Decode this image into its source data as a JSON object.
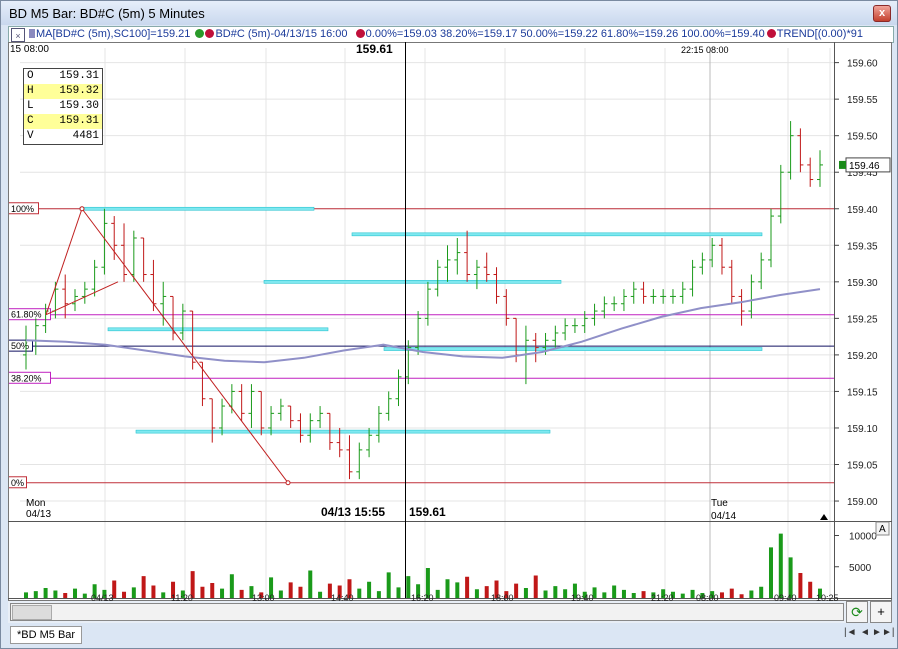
{
  "window": {
    "title": "BD M5 Bar: BD#C (5m) 5 Minutes",
    "close_glyph": "x"
  },
  "legend": {
    "items": [
      {
        "text": "MA[BD#C (5m),SC100]=159.21",
        "color": "#8a8abf"
      },
      {
        "text": "BD#C (5m)-04/13/15 16:00",
        "color": "#2a9a2a"
      },
      {
        "text": "0.00%=159.03 38.20%=159.17 50.00%=159.22 61.80%=159.26 100.00%=159.40",
        "color": "#c0103a"
      },
      {
        "text": "TREND[(0.00)*91",
        "color": "#c0103a"
      }
    ]
  },
  "chart_header": {
    "left_date": "15 08:00",
    "cursor_price": "159.61",
    "right_time": "22:15 08:00"
  },
  "ohlc_box": [
    {
      "k": "O",
      "v": "159.31",
      "hl": false
    },
    {
      "k": "H",
      "v": "159.32",
      "hl": true
    },
    {
      "k": "L",
      "v": "159.30",
      "hl": false
    },
    {
      "k": "C",
      "v": "159.31",
      "hl": true
    },
    {
      "k": "V",
      "v": "4481",
      "hl": false
    }
  ],
  "fib_levels": [
    {
      "label": "100%",
      "price": 159.4,
      "color": "#c0303a"
    },
    {
      "label": "61.80%",
      "price": 159.255,
      "color": "#c020c0"
    },
    {
      "label": "50%",
      "price": 159.212,
      "color": "#101060"
    },
    {
      "label": "38.20%",
      "price": 159.168,
      "color": "#c020c0"
    },
    {
      "label": "0%",
      "price": 159.025,
      "color": "#c0303a"
    }
  ],
  "price_axis": {
    "ticks": [
      "159.60",
      "159.55",
      "159.50",
      "159.45",
      "159.40",
      "159.35",
      "159.30",
      "159.25",
      "159.20",
      "159.15",
      "159.10",
      "159.05",
      "159.00"
    ],
    "last_price": "159.46",
    "last_price_color": "#1a8a1a"
  },
  "volume_axis": {
    "ticks": [
      "10000",
      "5000"
    ],
    "mode_button": "A"
  },
  "time_axis": {
    "ticks": [
      "04/13",
      "11:20",
      "13:00",
      "14:40",
      "16:20",
      "18:00",
      "19:40",
      "21:20",
      "08:00",
      "09:40",
      "10:25"
    ]
  },
  "day_labels": [
    {
      "day": "Mon",
      "date": "04/13"
    },
    {
      "day": "Tue",
      "date": "04/14"
    }
  ],
  "cursor_readout": {
    "datetime": "04/13 15:55",
    "price": "159.61"
  },
  "bottom": {
    "sync_glyph": "⟳",
    "plus_glyph": "+"
  },
  "tabs": [
    {
      "label": "*BD M5 Bar"
    }
  ],
  "tab_nav": {
    "first": "|◄",
    "prev": "◄",
    "next": "►",
    "last": "►|"
  },
  "chart_data": {
    "type": "bar",
    "symbol": "BD#C (5m)",
    "ylim": [
      158.985,
      159.62
    ],
    "price_bars": [
      [
        159.2,
        159.24,
        159.18,
        159.22
      ],
      [
        159.22,
        159.25,
        159.2,
        159.24
      ],
      [
        159.24,
        159.27,
        159.23,
        159.26
      ],
      [
        159.26,
        159.3,
        159.25,
        159.29
      ],
      [
        159.29,
        159.31,
        159.25,
        159.27
      ],
      [
        159.27,
        159.29,
        159.26,
        159.28
      ],
      [
        159.28,
        159.3,
        159.27,
        159.29
      ],
      [
        159.29,
        159.33,
        159.28,
        159.32
      ],
      [
        159.32,
        159.4,
        159.31,
        159.38
      ],
      [
        159.38,
        159.39,
        159.33,
        159.35
      ],
      [
        159.35,
        159.38,
        159.3,
        159.31
      ],
      [
        159.31,
        159.37,
        159.3,
        159.36
      ],
      [
        159.36,
        159.36,
        159.3,
        159.31
      ],
      [
        159.31,
        159.33,
        159.26,
        159.27
      ],
      [
        159.27,
        159.3,
        159.24,
        159.28
      ],
      [
        159.28,
        159.28,
        159.22,
        159.23
      ],
      [
        159.23,
        159.27,
        159.22,
        159.26
      ],
      [
        159.26,
        159.26,
        159.18,
        159.19
      ],
      [
        159.19,
        159.19,
        159.13,
        159.14
      ],
      [
        159.14,
        159.14,
        159.08,
        159.1
      ],
      [
        159.1,
        159.14,
        159.09,
        159.13
      ],
      [
        159.13,
        159.16,
        159.12,
        159.15
      ],
      [
        159.15,
        159.16,
        159.11,
        159.12
      ],
      [
        159.12,
        159.16,
        159.1,
        159.15
      ],
      [
        159.15,
        159.15,
        159.09,
        159.1
      ],
      [
        159.1,
        159.13,
        159.09,
        159.12
      ],
      [
        159.12,
        159.14,
        159.11,
        159.13
      ],
      [
        159.13,
        159.13,
        159.1,
        159.11
      ],
      [
        159.11,
        159.12,
        159.08,
        159.09
      ],
      [
        159.09,
        159.12,
        159.08,
        159.11
      ],
      [
        159.11,
        159.13,
        159.1,
        159.12
      ],
      [
        159.12,
        159.12,
        159.07,
        159.08
      ],
      [
        159.08,
        159.1,
        159.06,
        159.07
      ],
      [
        159.07,
        159.09,
        159.03,
        159.04
      ],
      [
        159.04,
        159.08,
        159.03,
        159.07
      ],
      [
        159.07,
        159.1,
        159.06,
        159.09
      ],
      [
        159.09,
        159.13,
        159.08,
        159.12
      ],
      [
        159.12,
        159.15,
        159.11,
        159.14
      ],
      [
        159.14,
        159.18,
        159.13,
        159.17
      ],
      [
        159.17,
        159.22,
        159.16,
        159.21
      ],
      [
        159.21,
        159.26,
        159.2,
        159.25
      ],
      [
        159.25,
        159.3,
        159.24,
        159.29
      ],
      [
        159.29,
        159.33,
        159.28,
        159.32
      ],
      [
        159.32,
        159.35,
        159.3,
        159.33
      ],
      [
        159.33,
        159.36,
        159.31,
        159.34
      ],
      [
        159.34,
        159.37,
        159.3,
        159.31
      ],
      [
        159.31,
        159.33,
        159.29,
        159.32
      ],
      [
        159.32,
        159.34,
        159.3,
        159.31
      ],
      [
        159.31,
        159.32,
        159.27,
        159.28
      ],
      [
        159.28,
        159.29,
        159.24,
        159.25
      ],
      [
        159.25,
        159.25,
        159.19,
        159.2
      ],
      [
        159.2,
        159.24,
        159.16,
        159.22
      ],
      [
        159.22,
        159.23,
        159.19,
        159.21
      ],
      [
        159.21,
        159.23,
        159.2,
        159.22
      ],
      [
        159.22,
        159.24,
        159.21,
        159.23
      ],
      [
        159.23,
        159.25,
        159.22,
        159.24
      ],
      [
        159.24,
        159.25,
        159.23,
        159.24
      ],
      [
        159.24,
        159.26,
        159.23,
        159.25
      ],
      [
        159.25,
        159.27,
        159.24,
        159.26
      ],
      [
        159.26,
        159.28,
        159.25,
        159.27
      ],
      [
        159.27,
        159.28,
        159.26,
        159.27
      ],
      [
        159.27,
        159.29,
        159.26,
        159.28
      ],
      [
        159.28,
        159.3,
        159.27,
        159.29
      ],
      [
        159.29,
        159.3,
        159.27,
        159.28
      ],
      [
        159.28,
        159.29,
        159.27,
        159.28
      ],
      [
        159.28,
        159.29,
        159.27,
        159.28
      ],
      [
        159.28,
        159.29,
        159.27,
        159.28
      ],
      [
        159.28,
        159.3,
        159.27,
        159.29
      ],
      [
        159.29,
        159.33,
        159.28,
        159.32
      ],
      [
        159.32,
        159.34,
        159.31,
        159.33
      ],
      [
        159.33,
        159.36,
        159.32,
        159.35
      ],
      [
        159.35,
        159.36,
        159.31,
        159.32
      ],
      [
        159.32,
        159.33,
        159.27,
        159.28
      ],
      [
        159.28,
        159.29,
        159.24,
        159.26
      ],
      [
        159.26,
        159.31,
        159.25,
        159.3
      ],
      [
        159.3,
        159.34,
        159.29,
        159.33
      ],
      [
        159.33,
        159.4,
        159.32,
        159.39
      ],
      [
        159.39,
        159.46,
        159.38,
        159.45
      ],
      [
        159.45,
        159.52,
        159.44,
        159.5
      ],
      [
        159.5,
        159.51,
        159.45,
        159.46
      ],
      [
        159.46,
        159.47,
        159.43,
        159.44
      ],
      [
        159.44,
        159.48,
        159.43,
        159.46
      ]
    ],
    "moving_average_values": [
      159.22,
      159.218,
      159.214,
      159.206,
      159.198,
      159.192,
      159.19,
      159.196,
      159.206,
      159.214,
      159.204,
      159.198,
      159.196,
      159.204,
      159.218,
      159.236,
      159.252,
      159.264,
      159.272,
      159.282,
      159.29
    ],
    "volumes": [
      900,
      1100,
      1600,
      1200,
      800,
      1500,
      700,
      2200,
      1300,
      2800,
      1000,
      1700,
      3500,
      2000,
      900,
      2600,
      1200,
      4300,
      1800,
      2400,
      1500,
      3800,
      1300,
      1900,
      900,
      3300,
      1200,
      2500,
      1800,
      4400,
      1000,
      2300,
      2000,
      3000,
      1500,
      2600,
      1100,
      4100,
      1700,
      3500,
      2200,
      4800,
      1300,
      3000,
      2500,
      3400,
      1400,
      1900,
      2800,
      1100,
      2300,
      1600,
      3600,
      1200,
      1900,
      1400,
      2300,
      1000,
      1700,
      900,
      2000,
      1300,
      800,
      1100,
      900,
      1400,
      1000,
      700,
      1300,
      800,
      1100,
      900,
      1500,
      600,
      1200,
      1800,
      8100,
      10300,
      6500,
      4000,
      2600,
      1500
    ],
    "volume_ylim": [
      0,
      12000
    ]
  }
}
